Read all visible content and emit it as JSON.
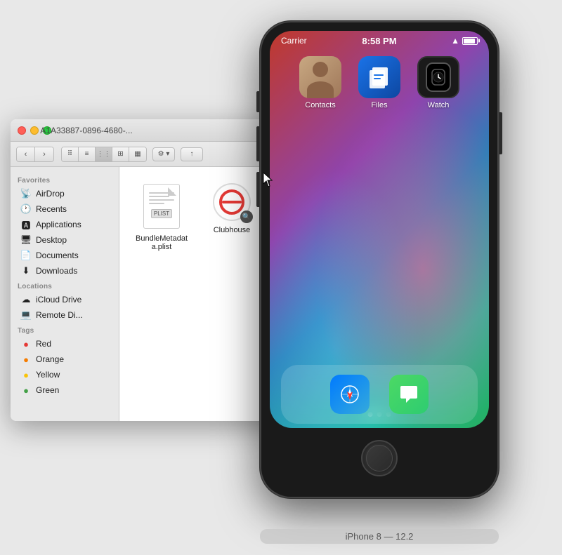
{
  "finder": {
    "title": "A1A33887-0896-4680-...",
    "sidebar": {
      "sections": [
        {
          "label": "Favorites",
          "items": [
            {
              "icon": "airdrop",
              "label": "AirDrop"
            },
            {
              "icon": "recents",
              "label": "Recents"
            },
            {
              "icon": "applications",
              "label": "Applications"
            },
            {
              "icon": "desktop",
              "label": "Desktop"
            },
            {
              "icon": "documents",
              "label": "Documents"
            },
            {
              "icon": "downloads",
              "label": "Downloads"
            }
          ]
        },
        {
          "label": "Locations",
          "items": [
            {
              "icon": "icloud",
              "label": "iCloud Drive"
            },
            {
              "icon": "remote",
              "label": "Remote Di..."
            }
          ]
        },
        {
          "label": "Tags",
          "items": [
            {
              "icon": "red",
              "label": "Red"
            },
            {
              "icon": "orange",
              "label": "Orange"
            },
            {
              "icon": "yellow",
              "label": "Yellow"
            },
            {
              "icon": "green",
              "label": "Green"
            }
          ]
        }
      ]
    },
    "files": [
      {
        "name": "BundleMetadata.plist",
        "type": "plist"
      },
      {
        "name": "Clubhouse",
        "type": "app"
      }
    ]
  },
  "iphone": {
    "status": {
      "carrier": "Carrier",
      "time": "8:58 PM"
    },
    "apps": [
      {
        "name": "Contacts",
        "type": "contacts"
      },
      {
        "name": "Files",
        "type": "files"
      },
      {
        "name": "Watch",
        "type": "watch"
      }
    ],
    "dock": [
      {
        "name": "Safari",
        "type": "safari"
      },
      {
        "name": "Messages",
        "type": "messages"
      }
    ],
    "device_label": "iPhone 8 — 12.2"
  }
}
